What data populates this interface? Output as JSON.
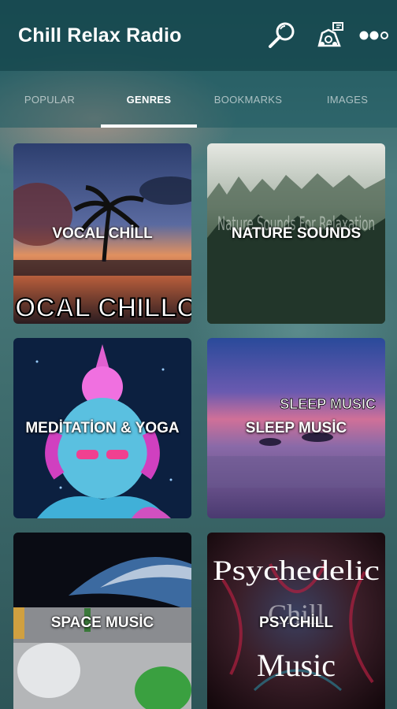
{
  "app": {
    "title": "Chill Relax Radio"
  },
  "toolbar": {
    "search_icon": "search-icon",
    "themes_icon": "themes-icon",
    "more_icon": "more-dots-icon"
  },
  "tabs": [
    {
      "label": "POPULAR",
      "active": false
    },
    {
      "label": "GENRES",
      "active": true
    },
    {
      "label": "BOOKMARKS",
      "active": false
    },
    {
      "label": "IMAGES",
      "active": false
    }
  ],
  "genres": [
    {
      "label": "VOCAL CHİLL",
      "art_caption": "OCAL CHILLOU"
    },
    {
      "label": "NATURE SOUNDS",
      "art_caption": "Nature Sounds For Relaxation"
    },
    {
      "label": "MEDİTATİON & YOGA"
    },
    {
      "label": "SLEEP MUSİC",
      "art_caption": "SLEEP MUSIC"
    },
    {
      "label": "SPACE MUSİC"
    },
    {
      "label": "PSYCHİLL",
      "art_caption_top": "Psychedelic",
      "art_caption_mid": "Chill",
      "art_caption_bottom": "Music"
    }
  ],
  "colors": {
    "appbar": "#16484e",
    "accent": "#ffffff"
  }
}
